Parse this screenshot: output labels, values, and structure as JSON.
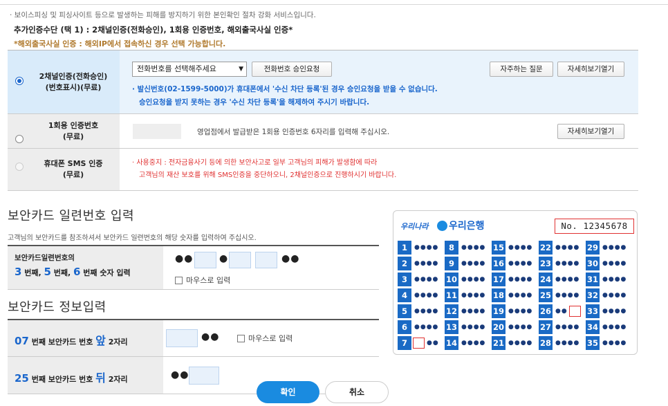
{
  "notice": "· 보이스피싱 및 피싱사이트 등으로 발생하는 피해를 방지하기 위한 본인확인 절차 강화 서비스입니다.",
  "additional_auth": "추가인증수단 (택 1) : 2채널인증(전화승인), 1회용 인증번호, 해외출국사실 인증*",
  "foreign_note": "*해외출국사실 인증 : 해외IP에서 접속하신 경우 선택 가능합니다.",
  "options": {
    "two_channel": {
      "label1": "2채널인증(전화승인)",
      "label2": "(번호표시)(무료)",
      "select_value": "전화번호를 선택해주세요",
      "approve_btn": "전화번호 승인요청",
      "faq_btn": "자주하는 질문",
      "detail_btn": "자세히보기열기",
      "note1": "· 발신번호(02-1599-5000)가 휴대폰에서 '수신 차단 등록'된 경우 승인요청을 받을 수 없습니다.",
      "note2": "승인요청을 받지 못하는 경우 '수신 차단 등록'을 해제하여 주시기 바랍니다.",
      "selected": true
    },
    "otp": {
      "label1": "1회용 인증번호",
      "label2": "(무료)",
      "desc": "영업점에서 발급받은 1회용 인증번호 6자리를 입력해 주십시오.",
      "detail_btn": "자세히보기열기"
    },
    "sms": {
      "label1": "휴대폰 SMS 인증",
      "label2": "(무료)",
      "note1": "· 사용중지 : 전자금융사기 등에 의한 보안사고로 일부 고객님의 피해가 발생함에 따라",
      "note2": "고객님의 재산 보호를 위해 SMS인증을 중단하오니, 2채널인증으로 진행하시기 바랍니다."
    }
  },
  "serial_section": {
    "title": "보안카드 일련번호 입력",
    "sub": "고객님의 보안카드를 참조하셔서 보안카드 일련번호의 해당 숫자를 입력하여 주십시오.",
    "row_label1": "보안카드일련번호의",
    "n1": "3",
    "t1": " 번째, ",
    "n2": "5",
    "t2": " 번째, ",
    "n3": "6",
    "t3": " 번째 숫자 입력",
    "dots": "●●",
    "dot": "●",
    "mouse_label": "마우스로 입력"
  },
  "info_section": {
    "title": "보안카드 정보입력",
    "row1_num": "07",
    "row1_mid": " 번째 보안카드 번호 ",
    "row1_pos": "앞",
    "row1_suffix": " 2자리",
    "row2_num": "25",
    "row2_mid": " 번째 보안카드 번호 ",
    "row2_pos": "뒤",
    "row2_suffix": " 2자리",
    "dots": "●●",
    "mouse_label": "마우스로 입력"
  },
  "card": {
    "logo_text": "우리나라",
    "bank_name": "우리은행",
    "serial_no": "No. 12345678",
    "mask": "●●●●",
    "half_mask": "●●",
    "numbers": [
      [
        "1",
        "8",
        "15",
        "22",
        "29"
      ],
      [
        "2",
        "9",
        "16",
        "23",
        "30"
      ],
      [
        "3",
        "10",
        "17",
        "24",
        "31"
      ],
      [
        "4",
        "11",
        "18",
        "25",
        "32"
      ],
      [
        "5",
        "12",
        "19",
        "26",
        "33"
      ],
      [
        "6",
        "13",
        "20",
        "27",
        "34"
      ],
      [
        "7",
        "14",
        "21",
        "28",
        "35"
      ]
    ]
  },
  "buttons": {
    "ok": "확인",
    "cancel": "취소"
  },
  "colors": {
    "accent": "#1a66cc",
    "warn": "#e03030",
    "card_blue": "#1a6ac5"
  }
}
